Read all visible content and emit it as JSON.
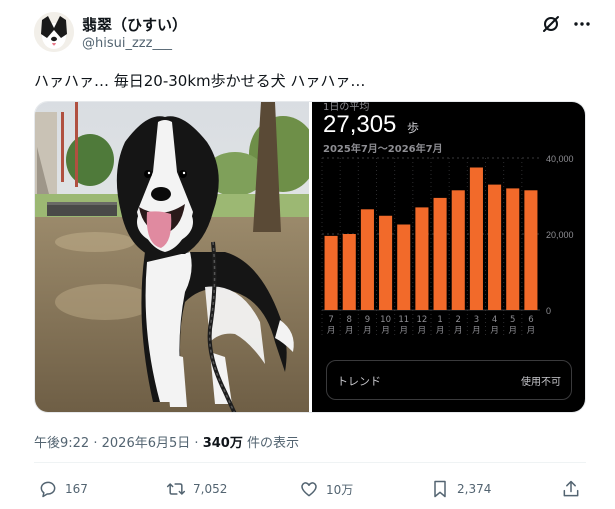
{
  "post": {
    "display_name": "翡翠（ひすい）",
    "handle": "@hisui_zzz___",
    "text": "ハァハァ… 毎日20-30km歩かせる犬 ハァハァ…"
  },
  "screenshot": {
    "header_partial": "1日の平均",
    "steps_value": "27,305",
    "steps_unit": "歩",
    "date_range": "2025年7月〜2026年7月",
    "trend_label": "トレンド",
    "trend_status": "使用不可"
  },
  "chart_data": {
    "type": "bar",
    "categories": [
      "7月",
      "8月",
      "9月",
      "10月",
      "11月",
      "12月",
      "1月",
      "2月",
      "3月",
      "4月",
      "5月",
      "6月"
    ],
    "values": [
      19500,
      20000,
      26500,
      24800,
      22500,
      27000,
      29500,
      31500,
      37500,
      33000,
      32000,
      31500
    ],
    "ylim": [
      0,
      40000
    ],
    "yticks": [
      "40,000",
      "20,000",
      "0"
    ],
    "ytick_values": [
      40000,
      20000,
      0
    ],
    "bar_color": "#f26a2a",
    "grid": true,
    "title": "",
    "xlabel": "",
    "ylabel": ""
  },
  "meta": {
    "time": "午後9:22",
    "separator": "·",
    "date": "2026年6月5日",
    "views_number": "340万",
    "views_suffix": "件の表示"
  },
  "actions": {
    "replies": "167",
    "reposts": "7,052",
    "likes": "10万",
    "bookmarks": "2,374"
  },
  "colors": {
    "text_primary": "#0f1419",
    "text_secondary": "#536471",
    "accent_bar": "#f26a2a"
  },
  "icons": [
    "avatar-dog-image",
    "grok-icon",
    "more-icon",
    "reply-icon",
    "repost-icon",
    "like-icon",
    "bookmark-icon",
    "share-icon"
  ]
}
